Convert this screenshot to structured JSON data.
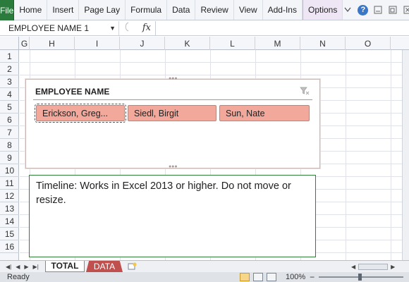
{
  "ribbon": {
    "file_label": "File",
    "tabs": [
      "Home",
      "Insert",
      "Page Lay",
      "Formula",
      "Data",
      "Review",
      "View",
      "Add-Ins",
      "Options"
    ],
    "help": "?"
  },
  "formula_bar": {
    "name_box": "EMPLOYEE NAME 1",
    "fx": "fx",
    "content": ""
  },
  "columns": [
    "G",
    "H",
    "I",
    "J",
    "K",
    "L",
    "M",
    "N",
    "O"
  ],
  "rows": [
    "1",
    "2",
    "3",
    "4",
    "5",
    "6",
    "7",
    "8",
    "9",
    "10",
    "11",
    "12",
    "13",
    "14",
    "15",
    "16"
  ],
  "slicer": {
    "title": "EMPLOYEE NAME",
    "items": [
      "Erickson, Greg...",
      "Siedl, Birgit",
      "Sun, Nate"
    ],
    "selected_index": 0,
    "item_color": "#f2a89a"
  },
  "timeline_box": {
    "text": "Timeline:  Works in Excel 2013 or higher. Do not move or resize."
  },
  "sheet_tabs": {
    "active": "TOTAL",
    "other": "DATA",
    "other_color": "#c0504d"
  },
  "status_bar": {
    "status": "Ready",
    "zoom": "100%"
  },
  "colors": {
    "file_tab": "#2b7b3c",
    "timeline_border": "#2f7f3a"
  }
}
